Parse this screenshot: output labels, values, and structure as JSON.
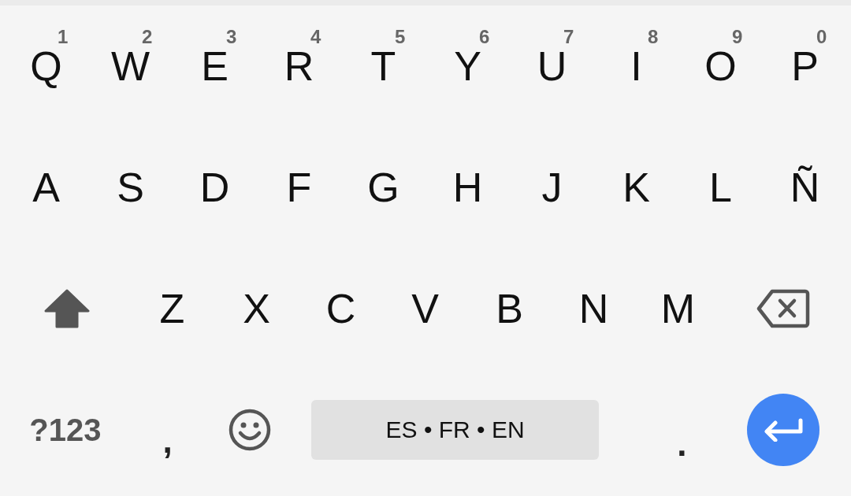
{
  "rows": [
    {
      "keys": [
        {
          "kind": "letter",
          "label": "Q",
          "hint": "1"
        },
        {
          "kind": "letter",
          "label": "W",
          "hint": "2"
        },
        {
          "kind": "letter",
          "label": "E",
          "hint": "3"
        },
        {
          "kind": "letter",
          "label": "R",
          "hint": "4"
        },
        {
          "kind": "letter",
          "label": "T",
          "hint": "5"
        },
        {
          "kind": "letter",
          "label": "Y",
          "hint": "6"
        },
        {
          "kind": "letter",
          "label": "U",
          "hint": "7"
        },
        {
          "kind": "letter",
          "label": "I",
          "hint": "8"
        },
        {
          "kind": "letter",
          "label": "O",
          "hint": "9"
        },
        {
          "kind": "letter",
          "label": "P",
          "hint": "0"
        }
      ]
    },
    {
      "keys": [
        {
          "kind": "letter",
          "label": "A"
        },
        {
          "kind": "letter",
          "label": "S"
        },
        {
          "kind": "letter",
          "label": "D"
        },
        {
          "kind": "letter",
          "label": "F"
        },
        {
          "kind": "letter",
          "label": "G"
        },
        {
          "kind": "letter",
          "label": "H"
        },
        {
          "kind": "letter",
          "label": "J"
        },
        {
          "kind": "letter",
          "label": "K"
        },
        {
          "kind": "letter",
          "label": "L"
        },
        {
          "kind": "letter",
          "label": "Ñ"
        }
      ]
    },
    {
      "keys": [
        {
          "kind": "shift"
        },
        {
          "kind": "letter",
          "label": "Z"
        },
        {
          "kind": "letter",
          "label": "X"
        },
        {
          "kind": "letter",
          "label": "C"
        },
        {
          "kind": "letter",
          "label": "V"
        },
        {
          "kind": "letter",
          "label": "B"
        },
        {
          "kind": "letter",
          "label": "N"
        },
        {
          "kind": "letter",
          "label": "M"
        },
        {
          "kind": "backspace"
        }
      ]
    },
    {
      "keys": [
        {
          "kind": "symbols",
          "label": "?123"
        },
        {
          "kind": "punct",
          "label": ","
        },
        {
          "kind": "emoji"
        },
        {
          "kind": "space",
          "label": "ES • FR • EN"
        },
        {
          "kind": "punct",
          "label": "."
        },
        {
          "kind": "enter"
        }
      ]
    }
  ]
}
